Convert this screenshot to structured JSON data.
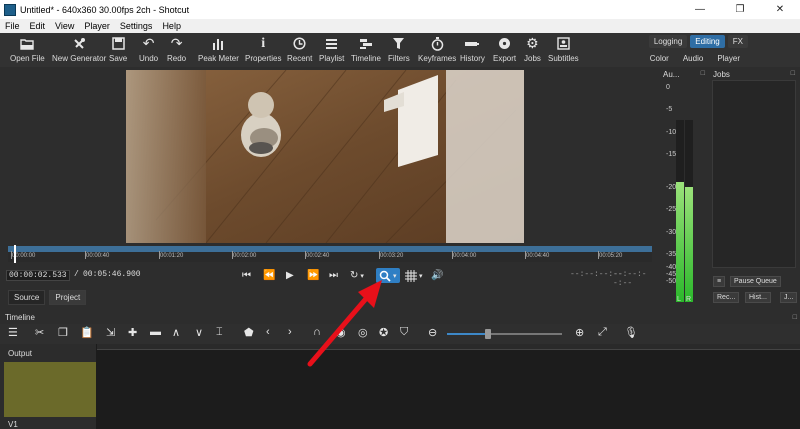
{
  "window": {
    "title": "Untitled* - 640x360 30.00fps 2ch - Shotcut",
    "minimize": "—",
    "maximize": "❐",
    "close": "✕"
  },
  "menu": [
    "File",
    "Edit",
    "View",
    "Player",
    "Settings",
    "Help"
  ],
  "toolbar": {
    "open_file": "Open File",
    "new_generator": "New Generator",
    "save": "Save",
    "undo": "Undo",
    "redo": "Redo",
    "peak_meter": "Peak Meter",
    "properties": "Properties",
    "recent": "Recent",
    "playlist": "Playlist",
    "timeline": "Timeline",
    "filters": "Filters",
    "keyframes": "Keyframes",
    "history": "History",
    "export": "Export",
    "jobs": "Jobs",
    "subtitles": "Subtitles"
  },
  "layouts": {
    "logging": "Logging",
    "editing": "Editing",
    "fx": "FX",
    "color": "Color",
    "audio": "Audio",
    "player": "Player"
  },
  "player": {
    "ruler_ticks": [
      "00:00:00",
      "00:00:40",
      "00:01:20",
      "00:02:00",
      "00:02:40",
      "00:03:20",
      "00:04:00",
      "00:04:40",
      "00:05:20"
    ],
    "position": "00:00:02.533",
    "separator": "/",
    "duration": "00:05:46.900",
    "in_point": "--:--:--:--",
    "out_point": "--:--:--:--",
    "source_tab": "Source",
    "project_tab": "Project"
  },
  "meter": {
    "title": "Au...",
    "close": "□",
    "scale": [
      "0",
      "-5",
      "-10",
      "-15",
      "-20",
      "-25",
      "-30",
      "-35",
      "-40",
      "-45",
      "-50"
    ],
    "left_label": "L",
    "right_label": "R",
    "left_level": 0.66,
    "right_level": 0.63
  },
  "jobs": {
    "title": "Jobs",
    "close": "□",
    "menu": "≡",
    "pause_queue": "Pause Queue",
    "recent": "Rec...",
    "history": "Hist...",
    "more": "J..."
  },
  "timeline": {
    "title": "Timeline",
    "close": "□",
    "output_label": "Output",
    "track_v1": "V1",
    "zoom_level": 0.36
  },
  "colors": {
    "accent": "#2f7fc4",
    "meter_green": "#2bb82b",
    "clip": "#6b6a2a",
    "arrow": "#e8101a"
  }
}
